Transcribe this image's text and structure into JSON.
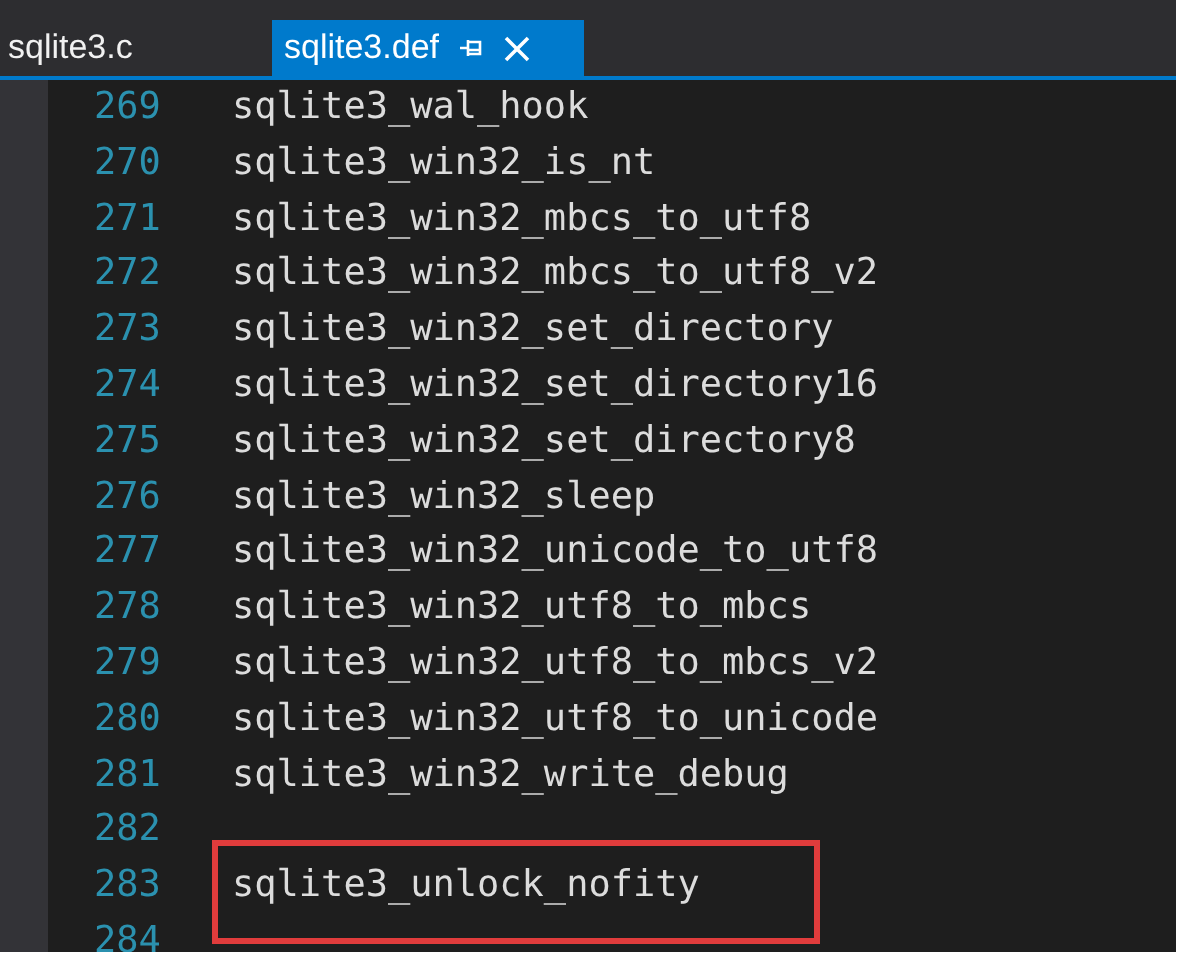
{
  "tabs": [
    {
      "label": "sqlite3.c",
      "selected": false,
      "pinned": false,
      "closable": false
    },
    {
      "label": "sqlite3.def",
      "selected": true,
      "pinned": true,
      "closable": true
    }
  ],
  "lines": [
    {
      "number": "269",
      "text": "sqlite3_wal_hook",
      "highlighted": false
    },
    {
      "number": "270",
      "text": "sqlite3_win32_is_nt",
      "highlighted": false
    },
    {
      "number": "271",
      "text": "sqlite3_win32_mbcs_to_utf8",
      "highlighted": false
    },
    {
      "number": "272",
      "text": "sqlite3_win32_mbcs_to_utf8_v2",
      "highlighted": false
    },
    {
      "number": "273",
      "text": "sqlite3_win32_set_directory",
      "highlighted": false
    },
    {
      "number": "274",
      "text": "sqlite3_win32_set_directory16",
      "highlighted": false
    },
    {
      "number": "275",
      "text": "sqlite3_win32_set_directory8",
      "highlighted": false
    },
    {
      "number": "276",
      "text": "sqlite3_win32_sleep",
      "highlighted": false
    },
    {
      "number": "277",
      "text": "sqlite3_win32_unicode_to_utf8",
      "highlighted": false
    },
    {
      "number": "278",
      "text": "sqlite3_win32_utf8_to_mbcs",
      "highlighted": false
    },
    {
      "number": "279",
      "text": "sqlite3_win32_utf8_to_mbcs_v2",
      "highlighted": false
    },
    {
      "number": "280",
      "text": "sqlite3_win32_utf8_to_unicode",
      "highlighted": false
    },
    {
      "number": "281",
      "text": "sqlite3_win32_write_debug",
      "highlighted": false
    },
    {
      "number": "282",
      "highlighted": false
    },
    {
      "number": "283",
      "text": "sqlite3_unlock_nofity",
      "highlighted": true
    },
    {
      "number": "284",
      "highlighted": false
    }
  ]
}
